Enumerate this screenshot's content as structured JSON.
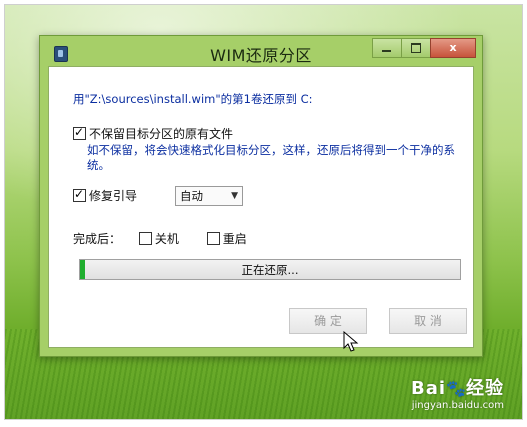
{
  "window": {
    "title": "WIM还原分区",
    "controls": {
      "minimize": "",
      "maximize": "",
      "close": "x"
    }
  },
  "main": {
    "info_text": "用\"Z:\\sources\\install.wim\"的第1卷还原到 C:",
    "keep_files": {
      "label": "不保留目标分区的原有文件",
      "checked": true,
      "description": "如不保留，将会快速格式化目标分区，这样，还原后将得到一个干净的系统。"
    },
    "repair_boot": {
      "label": "修复引导",
      "checked": true,
      "mode_selected": "自动"
    },
    "after_complete": {
      "label": "完成后：",
      "shutdown_label": "关机",
      "shutdown_checked": false,
      "restart_label": "重启",
      "restart_checked": false
    },
    "progress": {
      "text": "正在还原...",
      "fraction": 0.012
    },
    "ok_label": "确 定",
    "cancel_label": "取 消"
  },
  "watermark": {
    "brand": "Bai",
    "brand_suffix": "经验",
    "url": "jingyan.baidu.com"
  },
  "colors": {
    "window_frame": "#a6cf68",
    "progress_fill": "#1fae2e",
    "info_text": "#0b2ea0",
    "close_button": "#c7533b"
  },
  "icons": {
    "app": "wim-app-icon",
    "cursor": "mouse-pointer-icon"
  }
}
